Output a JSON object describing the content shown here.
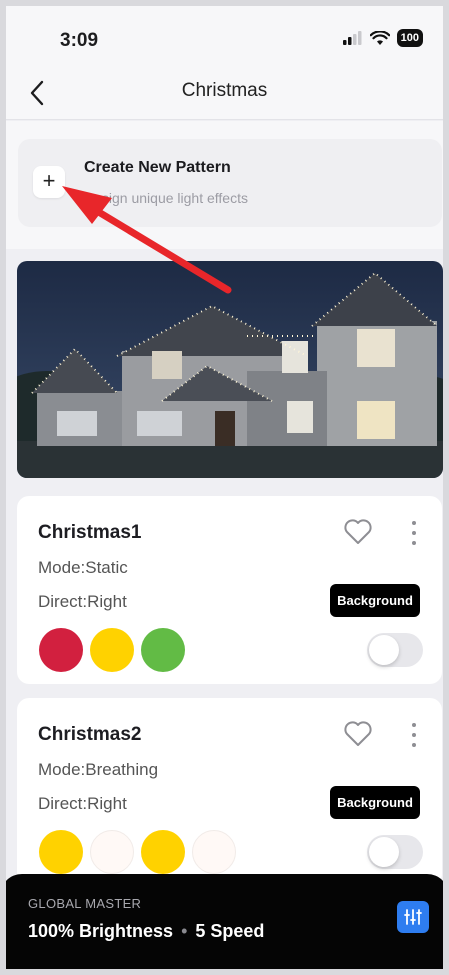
{
  "status_bar": {
    "time": "3:09",
    "battery": "100"
  },
  "nav": {
    "title": "Christmas"
  },
  "create": {
    "title": "Create New Pattern",
    "subtitle": "Design unique light effects",
    "plus": "+"
  },
  "patterns": [
    {
      "name": "Christmas1",
      "mode": "Mode:Static",
      "direct": "Direct:Right",
      "background_label": "Background",
      "colors": [
        "#d2203f",
        "#ffd200",
        "#62bb45"
      ],
      "enabled": false
    },
    {
      "name": "Christmas2",
      "mode": "Mode:Breathing",
      "direct": "Direct:Right",
      "background_label": "Background",
      "colors": [
        "#ffd200",
        "#fff9f6",
        "#ffd200",
        "#fff9f6"
      ],
      "enabled": false
    }
  ],
  "global_master": {
    "label": "GLOBAL MASTER",
    "brightness": "100% Brightness",
    "speed": "5 Speed"
  },
  "icons": {
    "back": "chevron-left-icon",
    "plus": "plus-icon",
    "heart": "heart-outline-icon",
    "more": "more-vertical-icon",
    "equalizer": "sliders-icon",
    "annotation": "red-arrow"
  },
  "accent_colors": {
    "arrow": "#e8262a",
    "global_button": "#2e7df0"
  }
}
